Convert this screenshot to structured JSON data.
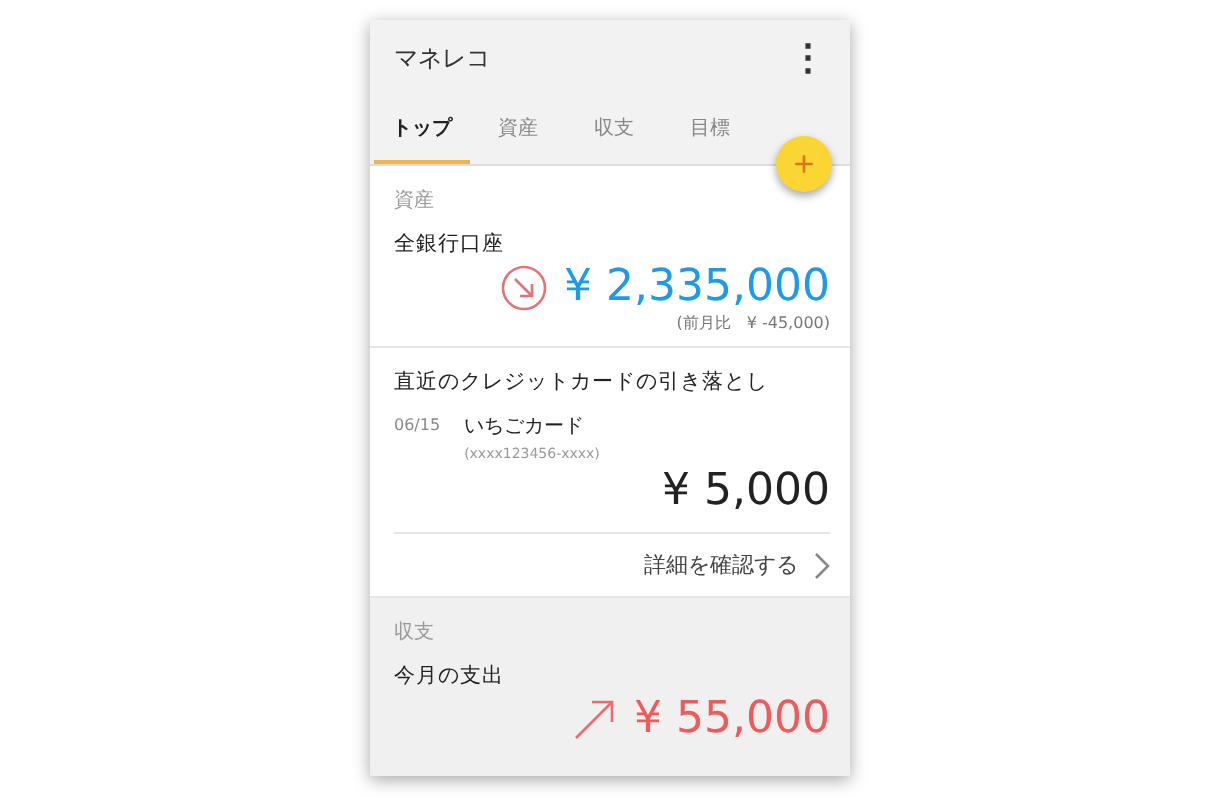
{
  "app_bar": {
    "title": "マネレコ",
    "menu": "⋮"
  },
  "tabs": [
    {
      "label": "トップ",
      "selected": true
    },
    {
      "label": "資産",
      "selected": false
    },
    {
      "label": "収支",
      "selected": false
    },
    {
      "label": "目標",
      "selected": false
    }
  ],
  "fab": {
    "label": "+"
  },
  "assets": {
    "heading": "資産",
    "label": "全銀行口座",
    "kind": "down",
    "amount": "¥ 2,335,000",
    "comparison": "(前月比　¥ -45,000)"
  },
  "credit": {
    "heading": "直近のクレジットカードの引き落とし",
    "date": "06/15",
    "card": "いちごカード",
    "number": "(xxxx123456-xxxx)",
    "amount": "¥ 5,000",
    "link": "詳細を確認する"
  },
  "balance": {
    "heading": "収支",
    "label": "今月の支出",
    "kind": "up",
    "amount": "¥ 55,000"
  }
}
